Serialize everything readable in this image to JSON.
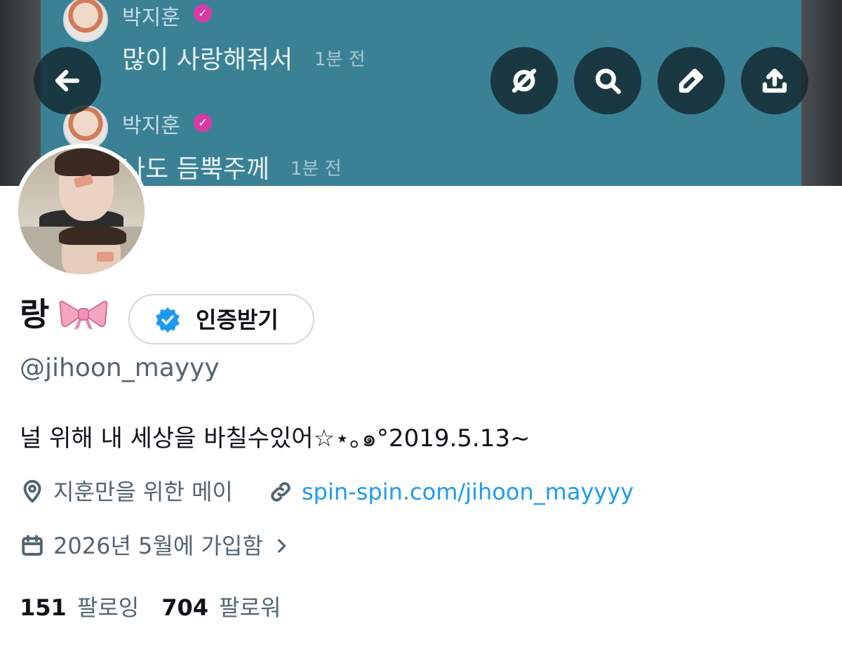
{
  "banner": {
    "messages": [
      {
        "name": "박지훈",
        "text": "많이 사랑해줘서",
        "time": "1분 전"
      },
      {
        "name": "박지훈",
        "text": "나도 듬뿍주께",
        "time": "1분 전"
      }
    ],
    "verified_mark": "✓"
  },
  "toolbar": {
    "back_icon": "back-arrow-icon",
    "grok_icon": "slashed-circle-icon",
    "search_icon": "search-icon",
    "edit_icon": "pencil-icon",
    "share_icon": "share-upload-icon"
  },
  "profile": {
    "display_name": "랑",
    "name_emoji": "ribbon-bow-icon",
    "verify_button_label": "인증받기",
    "handle": "@jihoon_mayyy",
    "bio": "널 위해 내 세상을 바칠수있어☆⋆｡๑°2019.5.13~",
    "location": "지훈만을 위한 메이",
    "website": "spin-spin.com/jihoon_mayyyy",
    "joined": "2026년 5월에 가입함",
    "following_count": "151",
    "following_label": "팔로잉",
    "followers_count": "704",
    "followers_label": "팔로워"
  },
  "colors": {
    "banner_bg": "#3b8195",
    "link": "#1d9bf0",
    "secondary_text": "#536471",
    "verified_blue": "#1d9bf0",
    "chat_verified_pink": "#d83aa6"
  }
}
